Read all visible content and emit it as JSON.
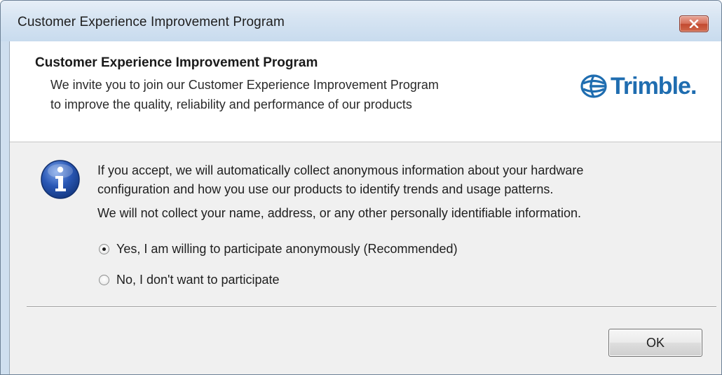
{
  "window": {
    "title": "Customer Experience Improvement Program"
  },
  "header": {
    "title": "Customer Experience Improvement Program",
    "line1": "We invite you to join our Customer Experience Improvement Program",
    "line2": "to improve the quality, reliability and performance of our products",
    "logo_text": "Trimble",
    "logo_color": "#1f6db0"
  },
  "body": {
    "icon": "info-icon",
    "line1": "If you accept, we will automatically collect anonymous information about your hardware",
    "line2": "configuration and how you use our products to identify trends and usage patterns.",
    "line3": "We will not collect your name, address, or any other personally identifiable information."
  },
  "options": [
    {
      "label": "Yes, I am willing to participate anonymously (Recommended)",
      "checked": true
    },
    {
      "label": "No, I don't want to participate",
      "checked": false
    }
  ],
  "buttons": {
    "ok_label": "OK"
  },
  "colors": {
    "titlebar": "#cfdfef",
    "close_button": "#c24a30",
    "info_icon": "#2a58b5"
  }
}
